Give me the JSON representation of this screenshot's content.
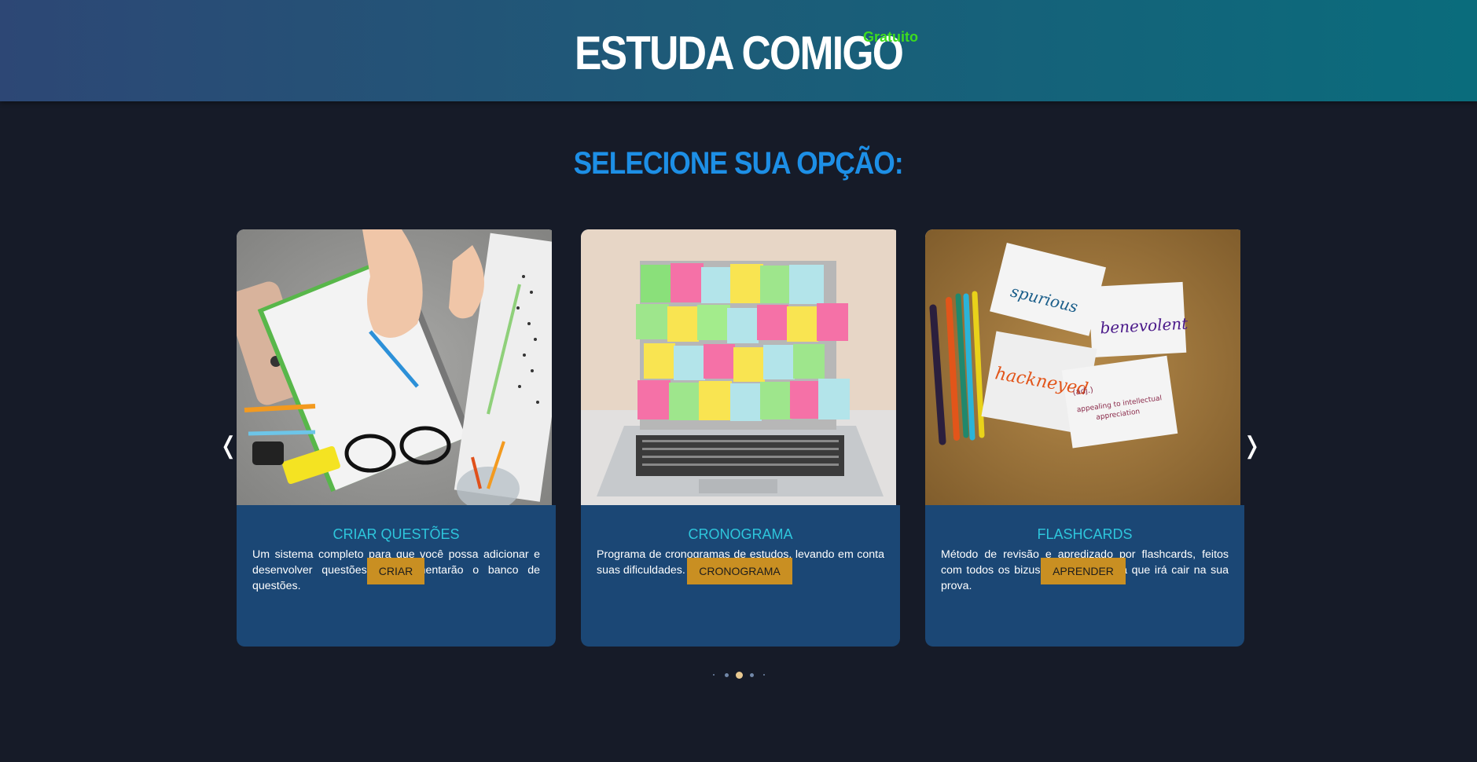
{
  "header": {
    "title": "ESTUDA COMIGO",
    "badge": "Gratuito"
  },
  "section": {
    "title": "SELECIONE SUA OPÇÃO:"
  },
  "carousel": {
    "prev_label": "❬",
    "next_label": "❭",
    "active_index": 2,
    "dot_count": 5,
    "accent_color": "#e8c890",
    "cards": [
      {
        "title": "CRIAR QUESTÕES",
        "description": "Um sistema completo para que você possa adicionar e desenvolver questões que aumentarão o banco de questões.",
        "button": "CRIAR",
        "image": "notebook-writing-desk-photo"
      },
      {
        "title": "CRONOGRAMA",
        "description": "Programa de cronogramas de estudos, levando em conta suas dificuldades.",
        "button": "CRONOGRAMA",
        "image": "laptop-sticky-notes-photo"
      },
      {
        "title": "FLASHCARDS",
        "description": "Método de revisão e apredizado por flashcards, feitos com todos os bizus de cada matéria que irá cair na sua prova.",
        "button": "APRENDER",
        "image": "flashcards-markers-photo",
        "flashcard_words": [
          "spurious",
          "benevolent",
          "hackneyed",
          "(adj.)",
          "appealing to intellectual appreciation"
        ]
      }
    ]
  },
  "colors": {
    "background": "#161b28",
    "header_gradient_start": "#2d4775",
    "header_gradient_end": "#0a6c7c",
    "section_title": "#1d8fe6",
    "badge": "#3ddc1e",
    "card_body": "#1b4775",
    "card_title": "#2ec6dc",
    "button": "#c98f22"
  }
}
